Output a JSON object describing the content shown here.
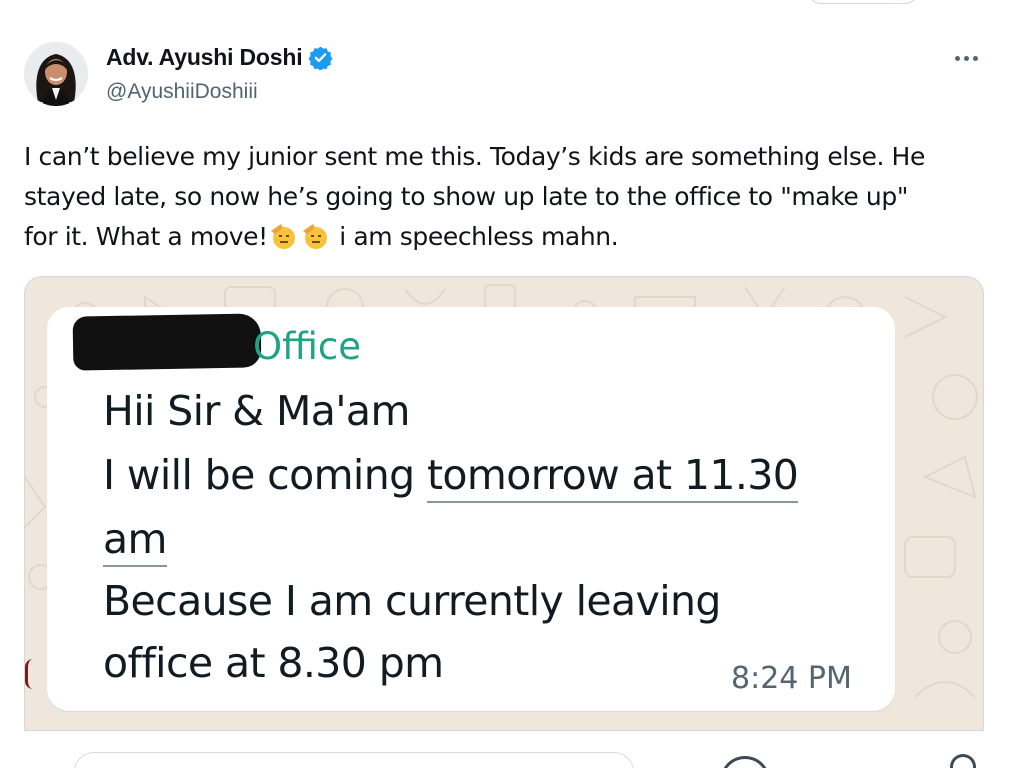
{
  "author": {
    "display_name": "Adv. Ayushi Doshi",
    "handle": "@AyushiiDoshiii",
    "verified_icon": "verified-badge-icon",
    "verified_color": "#1d9bf0"
  },
  "tweet": {
    "text_line1": "I can’t believe my junior sent me this. Today’s kids are something else. He",
    "text_line2": "stayed late, so now he’s going to show up late to the office to \"make up\"",
    "text_line3a": "for it. What a move!",
    "text_line3b": " i am speechless mahn.",
    "emoji": "saluting-face-emoji"
  },
  "media": {
    "group_name": "Office",
    "message_lines": [
      "Hii Sir & Ma'am",
      "I will be coming ",
      "tomorrow at 11.30",
      "am",
      "Because I am currently leaving",
      "office at 8.30 pm"
    ],
    "time": "8:24 PM",
    "bubble_color": "#ffffff",
    "group_name_color": "#1fa385",
    "wallpaper_color": "#efe7dc"
  },
  "actions": {
    "more_icon": "more-options-icon"
  }
}
